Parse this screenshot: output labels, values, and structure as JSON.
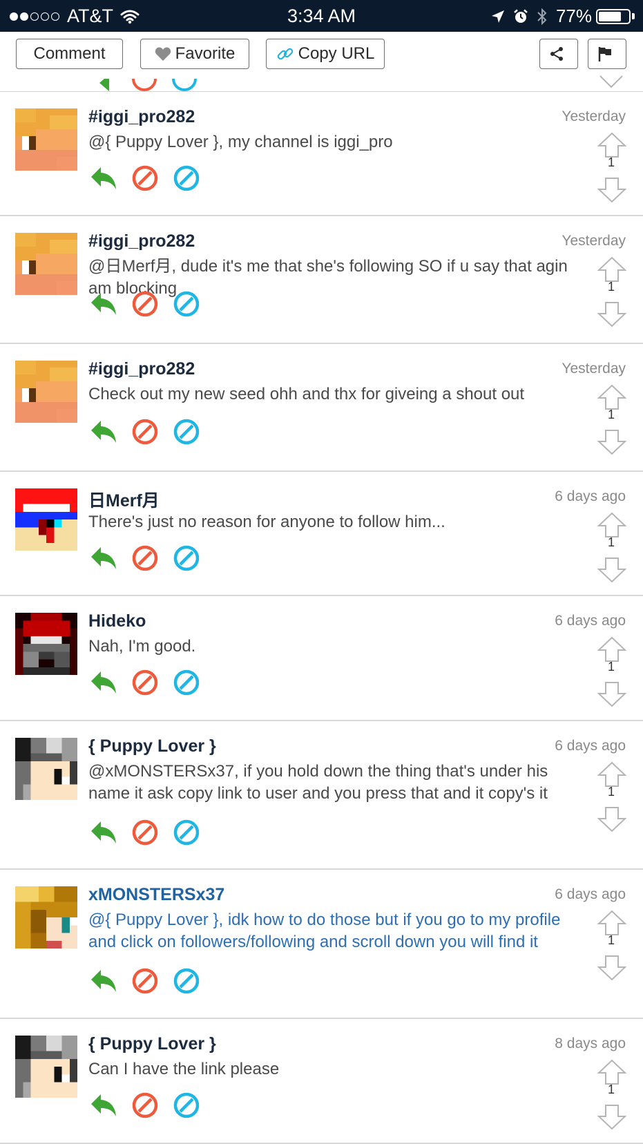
{
  "status_bar": {
    "carrier": "AT&T",
    "time": "3:34 AM",
    "battery": "77%",
    "battery_level": 0.77,
    "signal_bars_filled": 2,
    "signal_bars_total": 5
  },
  "toolbar": {
    "comment_label": "Comment",
    "favorite_label": "Favorite",
    "copy_url_label": "Copy URL"
  },
  "icons": {
    "reply": "reply-arrow-icon",
    "block": "block-icon",
    "ignore": "ignore-icon",
    "vote_up": "arrow-up-outline-icon",
    "vote_down": "arrow-down-outline-icon"
  },
  "colors": {
    "status_bar": "#0b1a2d",
    "reply": "#3fa535",
    "block": "#ee5a3c",
    "ignore": "#1fb6e4",
    "username": "#1c2b3d",
    "username_highlight": "#2163a0",
    "mention_text": "#2d6fb5",
    "timestamp": "#8a8a8a"
  },
  "comments": [
    {
      "username": "#iggi_pro282",
      "timestamp": "Yesterday",
      "text": "@{ Puppy Lover }, my channel is iggi_pro",
      "votes": "1",
      "avatar": "iggi-avatar",
      "highlight": false
    },
    {
      "username": "#iggi_pro282",
      "timestamp": "Yesterday",
      "text": "@日Merf月, dude it's me that she's following SO if u say that agin am blocking",
      "votes": "1",
      "avatar": "iggi-avatar",
      "highlight": false
    },
    {
      "username": "#iggi_pro282",
      "timestamp": "Yesterday",
      "text": "Check out my new seed ohh and thx for giveing a shout out",
      "votes": "1",
      "avatar": "iggi-avatar",
      "highlight": false
    },
    {
      "username": "日Merf月",
      "timestamp": "6 days ago",
      "text": "There's just no reason for anyone to follow him...",
      "votes": "1",
      "avatar": "merf-avatar",
      "highlight": false
    },
    {
      "username": "Hideko",
      "timestamp": "6 days ago",
      "text": "Nah, I'm good.",
      "votes": "1",
      "avatar": "hideko-avatar",
      "highlight": false
    },
    {
      "username": "{ Puppy Lover }",
      "timestamp": "6 days ago",
      "text": "@xMONSTERSx37, if you hold down the thing that's under his name it ask copy link to user and you press that and it copy's it",
      "votes": "1",
      "avatar": "puppy-avatar",
      "highlight": false
    },
    {
      "username": "xMONSTERSx37",
      "timestamp": "6 days ago",
      "text": "@{ Puppy Lover }, idk how to do those but if you go to my profile and click on followers/following and scroll down you will find it",
      "votes": "1",
      "avatar": "monsters-avatar",
      "highlight": true
    },
    {
      "username": "{ Puppy Lover }",
      "timestamp": "8 days ago",
      "text": "Can I have the link please",
      "votes": "1",
      "avatar": "puppy-avatar",
      "highlight": false
    }
  ]
}
